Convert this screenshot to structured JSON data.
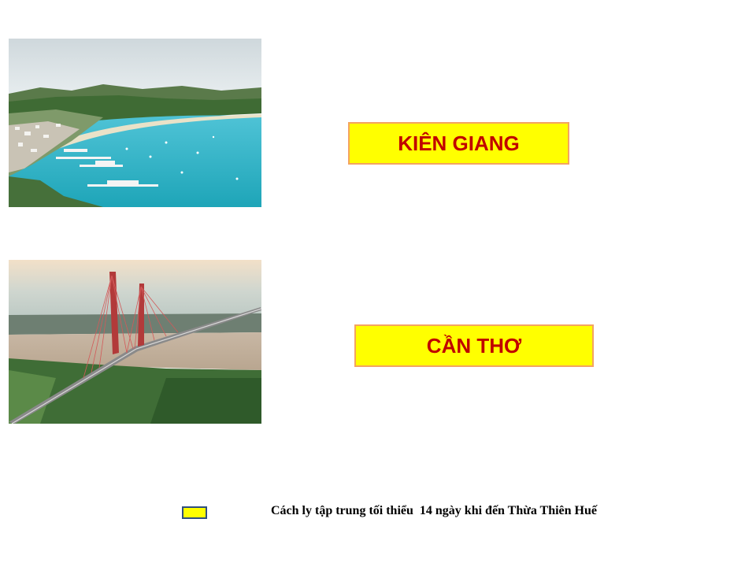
{
  "colors": {
    "box_fill": "#ffff00",
    "box_border": "#f4a460",
    "box_text": "#c00000",
    "legend_swatch_fill": "#ffff00",
    "legend_swatch_border": "#2f4f7f"
  },
  "provinces": [
    {
      "label": "KIÊN GIANG",
      "photo": "coastal-harbor-photo"
    },
    {
      "label": "CẦN THƠ",
      "photo": "cable-stayed-bridge-photo"
    }
  ],
  "legend": {
    "text": "Cách ly tập trung tối thiểu  14 ngày khi đến Thừa Thiên Huế"
  }
}
